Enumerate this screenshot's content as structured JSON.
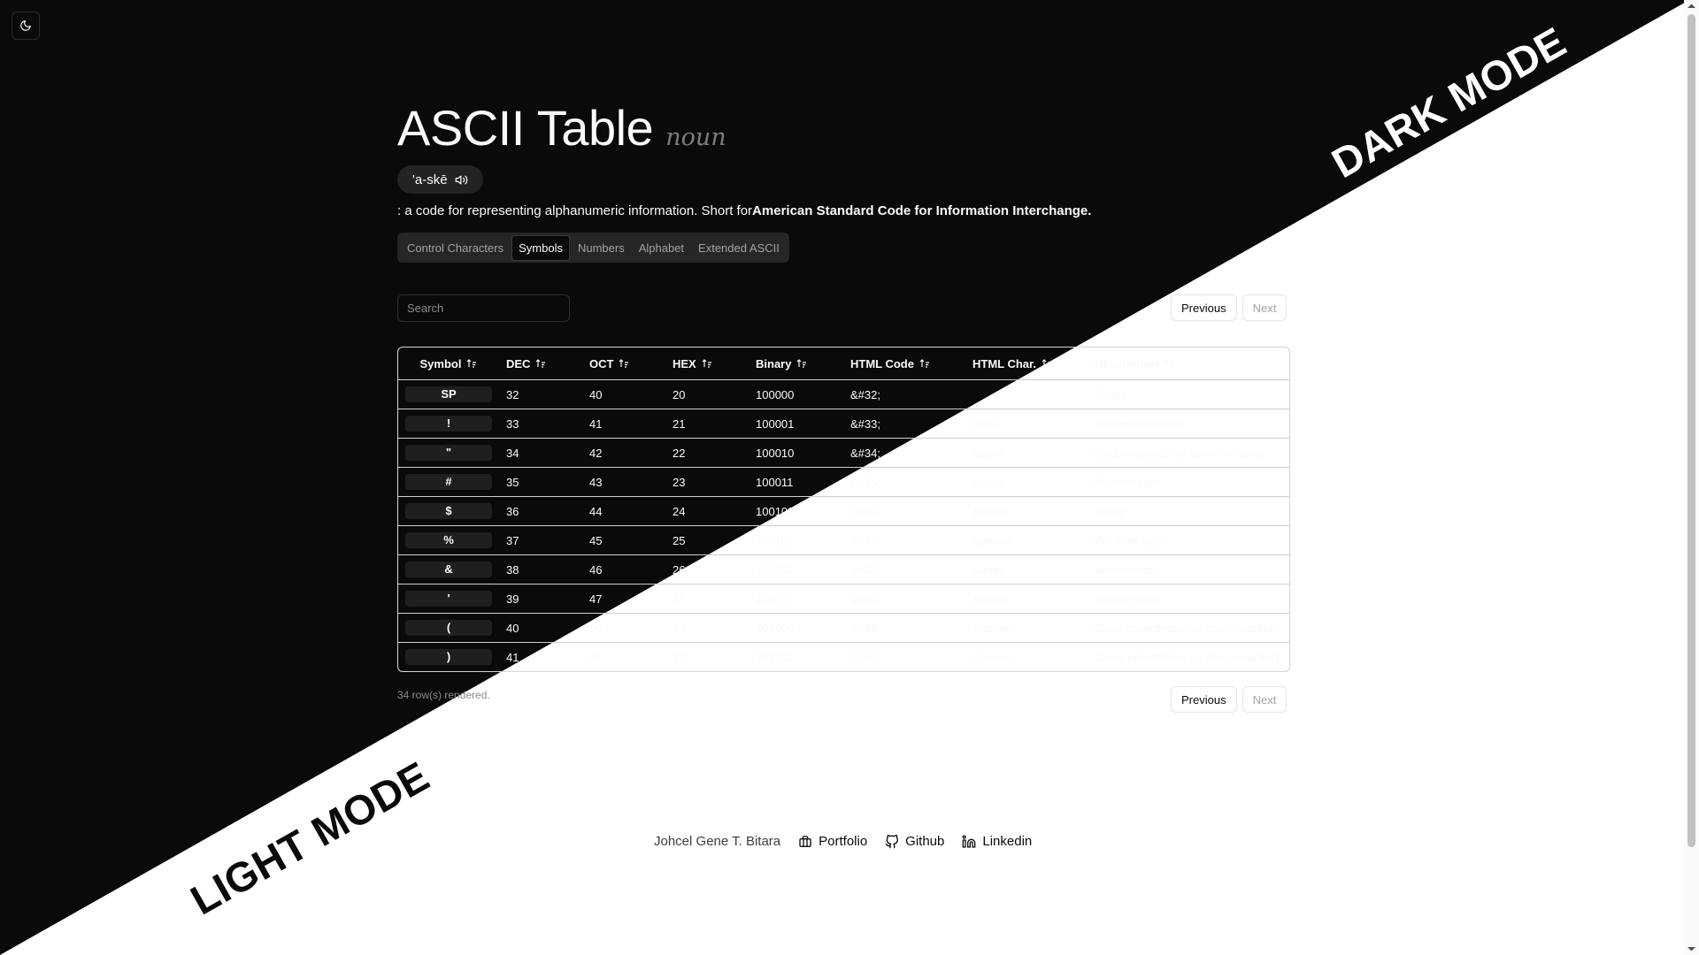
{
  "overlay": {
    "dark_label": "DARK MODE",
    "light_label": "LIGHT MODE"
  },
  "colors": {
    "dark_bg": "#0a0a0a",
    "light_bg": "#ffffff",
    "accent": "#fafafa"
  },
  "header": {
    "title": "ASCII Table",
    "part_of_speech": "noun",
    "pronunciation": "'a-skē",
    "definition_prefix": ": a code for representing alphanumeric information. Short for",
    "definition_bold": "American Standard Code for Information Interchange."
  },
  "tabs": [
    {
      "label": "Control Characters",
      "active": false
    },
    {
      "label": "Symbols",
      "active": true
    },
    {
      "label": "Numbers",
      "active": false
    },
    {
      "label": "Alphabet",
      "active": false
    },
    {
      "label": "Extended ASCII",
      "active": false
    }
  ],
  "search": {
    "placeholder": "Search",
    "value": ""
  },
  "pagination": {
    "previous": "Previous",
    "next": "Next"
  },
  "table": {
    "columns": [
      "Symbol",
      "DEC",
      "OCT",
      "HEX",
      "Binary",
      "HTML Code",
      "HTML Char.",
      "Description"
    ],
    "rows": [
      [
        "SP",
        "32",
        "40",
        "20",
        "100000",
        "&#32;",
        "",
        "Space"
      ],
      [
        "!",
        "33",
        "41",
        "21",
        "100001",
        "&#33;",
        "&excl;",
        "Exclamation mark"
      ],
      [
        "\"",
        "34",
        "42",
        "22",
        "100010",
        "&#34;",
        "&quot;",
        "Double quotes (or speech marks)"
      ],
      [
        "#",
        "35",
        "43",
        "23",
        "100011",
        "&#35;",
        "&num;",
        "Number sign"
      ],
      [
        "$",
        "36",
        "44",
        "24",
        "100100",
        "&#36;",
        "&dollar;",
        "Dollar"
      ],
      [
        "%",
        "37",
        "45",
        "25",
        "100101",
        "&#37;",
        "&percnt;",
        "Per cent sign"
      ],
      [
        "&",
        "38",
        "46",
        "26",
        "100110",
        "&#38;",
        "&amp;",
        "Ampersand"
      ],
      [
        "'",
        "39",
        "47",
        "27",
        "100111",
        "&#39;",
        "&apos;",
        "Single quote"
      ],
      [
        "(",
        "40",
        "50",
        "28",
        "101000",
        "&#40;",
        "&lparen;",
        "Open parenthesis (or open bracket)"
      ],
      [
        ")",
        "41",
        "51",
        "29",
        "101001",
        "&#41;",
        "&rparen;",
        "Close parenthesis (or close bracket)"
      ]
    ]
  },
  "status": {
    "row_count": "34 row(s) rendered."
  },
  "footer": {
    "author": "Johcel Gene T. Bitara",
    "links": [
      {
        "label": "Portfolio",
        "icon": "briefcase-icon"
      },
      {
        "label": "Github",
        "icon": "github-icon"
      },
      {
        "label": "Linkedin",
        "icon": "linkedin-icon"
      }
    ]
  }
}
